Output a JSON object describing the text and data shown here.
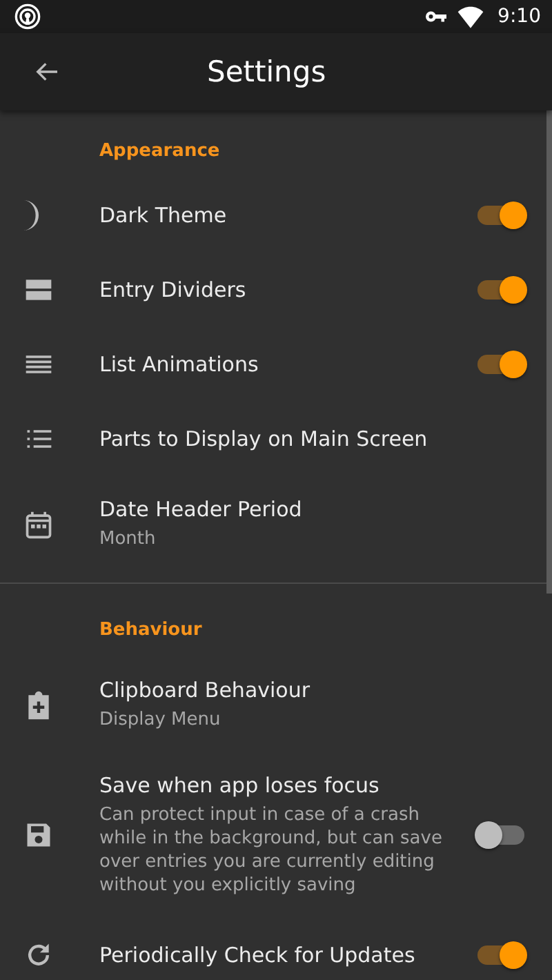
{
  "status_bar": {
    "time": "9:10"
  },
  "toolbar": {
    "title": "Settings"
  },
  "sections": [
    {
      "header": "Appearance",
      "items": [
        {
          "kind": "switch",
          "title": "Dark Theme",
          "on": true
        },
        {
          "kind": "switch",
          "title": "Entry Dividers",
          "on": true
        },
        {
          "kind": "switch",
          "title": "List Animations",
          "on": true
        },
        {
          "kind": "plain",
          "title": "Parts to Display on Main Screen"
        },
        {
          "kind": "plain",
          "title": "Date Header Period",
          "summary": "Month"
        }
      ]
    },
    {
      "header": "Behaviour",
      "items": [
        {
          "kind": "plain",
          "title": "Clipboard Behaviour",
          "summary": "Display Menu"
        },
        {
          "kind": "switch",
          "title": "Save when app loses focus",
          "summary": "Can protect input in case of a crash while in the background, but can save over entries you are currently editing without you explicitly saving",
          "on": false
        },
        {
          "kind": "switch",
          "title": "Periodically Check for Updates",
          "on": true
        }
      ]
    }
  ]
}
